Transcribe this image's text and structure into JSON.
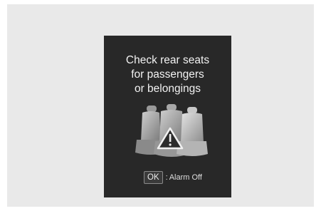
{
  "message": {
    "line1": "Check rear seats",
    "line2": "for passengers",
    "line3": "or belongings"
  },
  "illustration": {
    "icon": "rear-seats-warning-icon"
  },
  "action": {
    "ok_label": "OK",
    "separator": ":",
    "description": "Alarm Off"
  }
}
